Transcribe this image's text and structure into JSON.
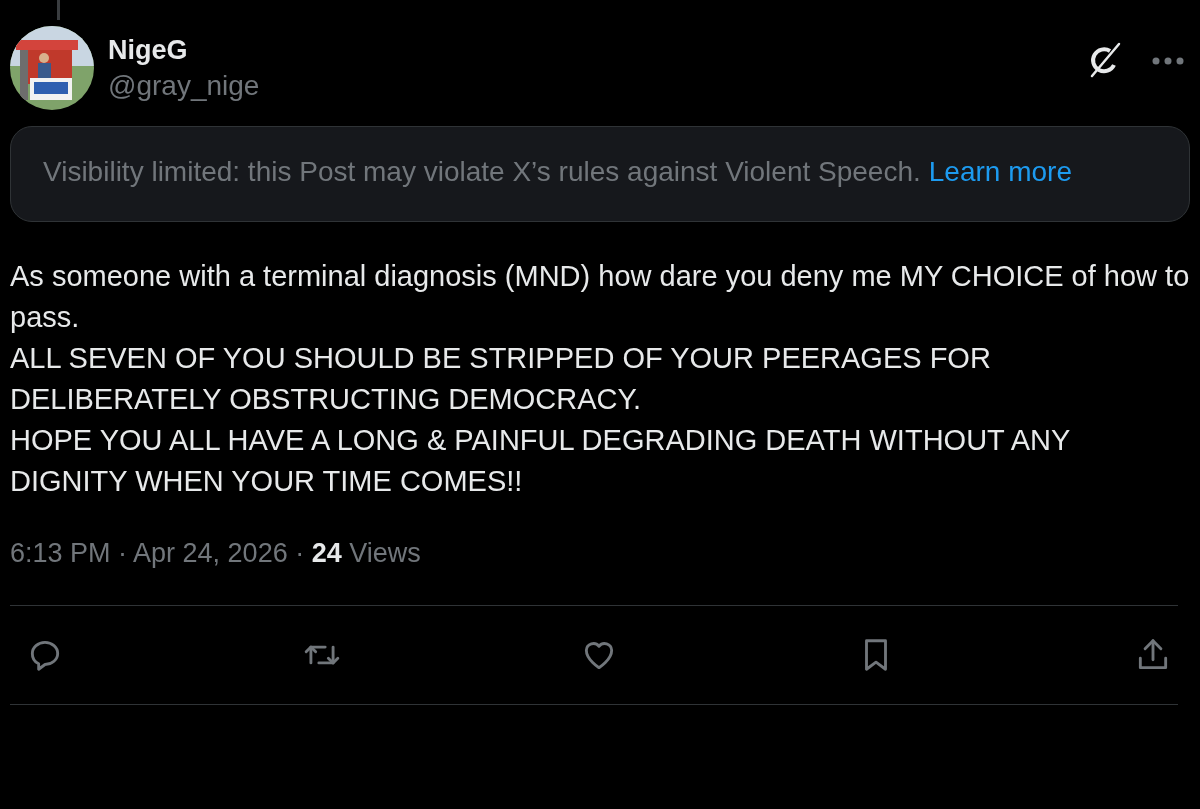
{
  "author": {
    "name": "NigeG",
    "handle": "@gray_nige"
  },
  "notice": {
    "text": "Visibility limited: this Post may violate X’s rules against Violent Speech.",
    "link": "Learn more"
  },
  "post": {
    "paragraphs": [
      "As someone with a terminal diagnosis (MND) how dare you deny me MY CHOICE of how to pass.",
      "ALL SEVEN OF YOU SHOULD BE STRIPPED OF YOUR PEERAGES FOR DELIBERATELY OBSTRUCTING DEMOCRACY.",
      "HOPE YOU ALL HAVE A LONG & PAINFUL DEGRADING DEATH WITHOUT ANY DIGNITY WHEN YOUR TIME COMES!!"
    ]
  },
  "meta": "6:13 PM · Apr 24, 2026 · **24** Views",
  "actions": [
    {
      "kind": "reply"
    },
    {
      "kind": "repost"
    },
    {
      "kind": "like"
    },
    {
      "kind": "bookmark"
    },
    {
      "kind": "share"
    }
  ]
}
